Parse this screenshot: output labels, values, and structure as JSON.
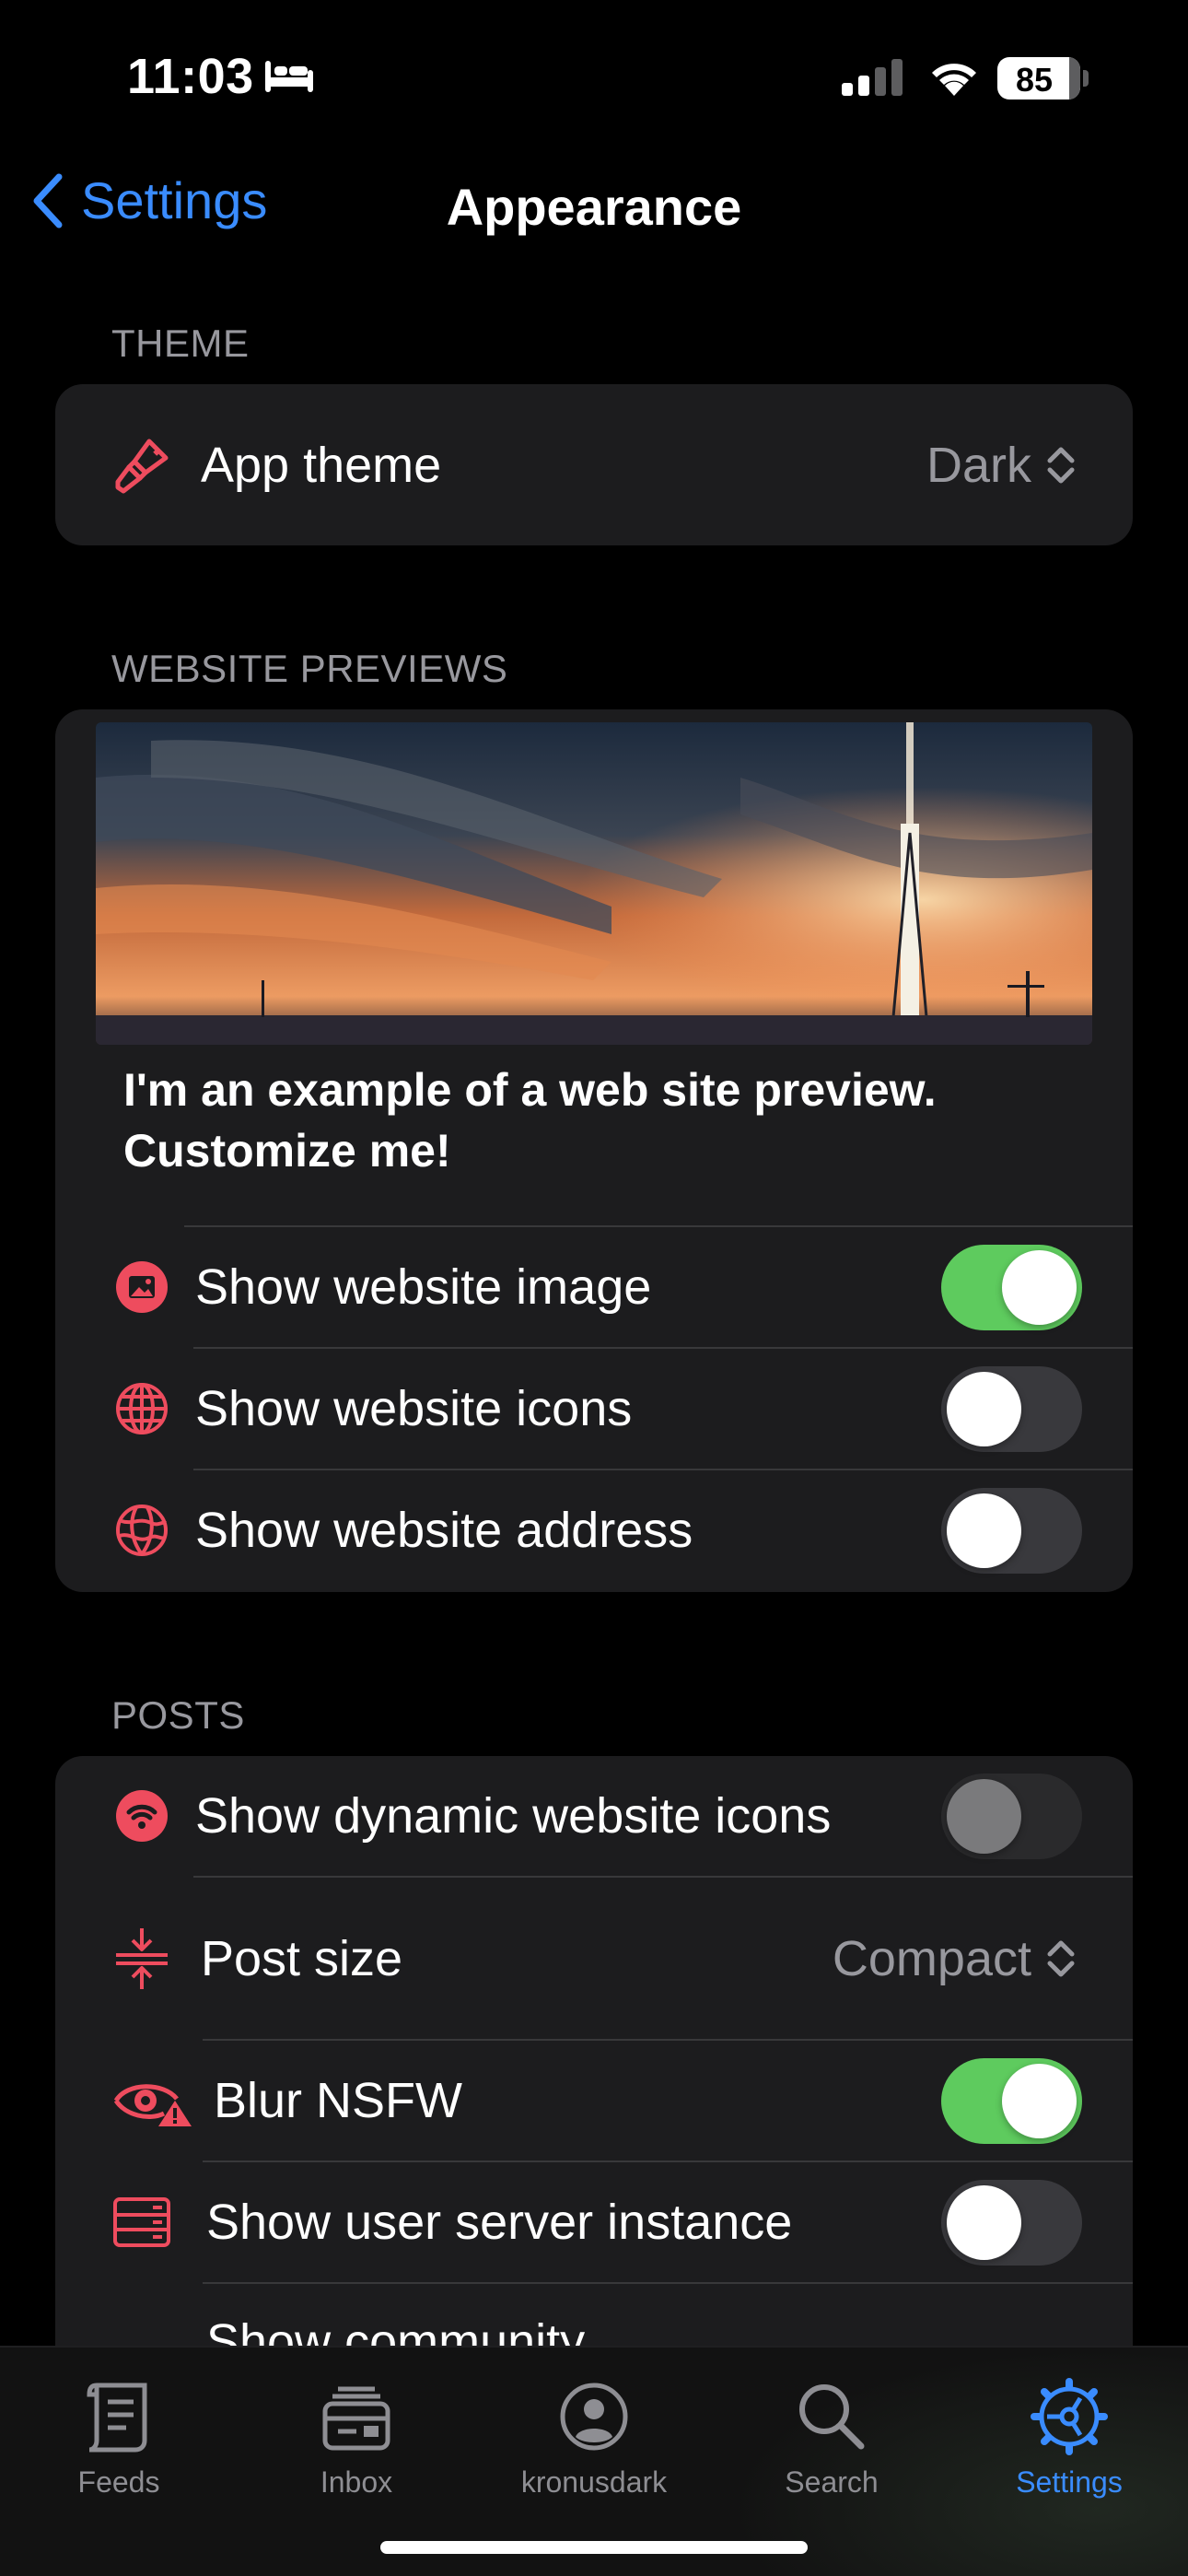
{
  "status_bar": {
    "time": "11:03",
    "battery": "85"
  },
  "nav": {
    "back_label": "Settings",
    "title": "Appearance"
  },
  "theme_section": {
    "header": "THEME",
    "app_theme_label": "App theme",
    "app_theme_value": "Dark"
  },
  "website_previews": {
    "header": "WEBSITE PREVIEWS",
    "preview_text": "I'm an example of a web site preview. Customize me!",
    "rows": [
      {
        "label": "Show website image",
        "on": true
      },
      {
        "label": "Show website icons",
        "on": false
      },
      {
        "label": "Show website address",
        "on": false
      }
    ]
  },
  "posts": {
    "header": "POSTS",
    "dynamic_icons_label": "Show dynamic website icons",
    "post_size_label": "Post size",
    "post_size_value": "Compact",
    "blur_nsfw_label": "Blur NSFW",
    "user_server_label": "Show user server instance",
    "community_label": "Show community"
  },
  "tabbar": {
    "tabs": [
      {
        "label": "Feeds",
        "icon": "feeds-icon"
      },
      {
        "label": "Inbox",
        "icon": "inbox-icon"
      },
      {
        "label": "kronusdark",
        "icon": "profile-icon"
      },
      {
        "label": "Search",
        "icon": "search-icon"
      },
      {
        "label": "Settings",
        "icon": "settings-icon",
        "active": true
      }
    ]
  },
  "colors": {
    "accent": "#3a8cff",
    "icon_red": "#ee4c5e",
    "toggle_on": "#5ecb5e",
    "card": "#1c1c1e"
  }
}
